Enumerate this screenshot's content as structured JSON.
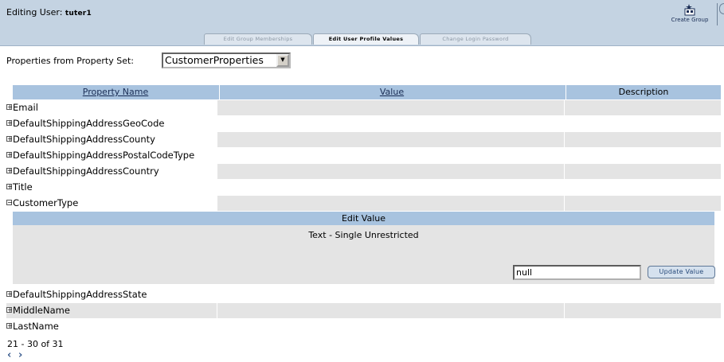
{
  "header": {
    "title_prefix": "Editing User: ",
    "username": "tuter1",
    "create_group_label": "Create Group"
  },
  "tabs": [
    {
      "label": "Edit Group Memberships",
      "active": false
    },
    {
      "label": "Edit User Profile Values",
      "active": true
    },
    {
      "label": "Change Login Password",
      "active": false
    }
  ],
  "property_set": {
    "label": "Properties from Property Set:",
    "selected": "CustomerProperties"
  },
  "table": {
    "columns": [
      "Property Name",
      "Value",
      "Description"
    ],
    "rows_before_edit": [
      {
        "name": "Email",
        "expander": "+"
      },
      {
        "name": "DefaultShippingAddressGeoCode",
        "expander": "+"
      },
      {
        "name": "DefaultShippingAddressCounty",
        "expander": "+"
      },
      {
        "name": "DefaultShippingAddressPostalCodeType",
        "expander": "+"
      },
      {
        "name": "DefaultShippingAddressCountry",
        "expander": "+"
      },
      {
        "name": "Title",
        "expander": "+"
      },
      {
        "name": "CustomerType",
        "expander": "−"
      }
    ],
    "rows_after_edit": [
      {
        "name": "DefaultShippingAddressState",
        "expander": "+"
      },
      {
        "name": "MiddleName",
        "expander": "+"
      },
      {
        "name": "LastName",
        "expander": "+"
      }
    ]
  },
  "edit_panel": {
    "heading": "Edit Value",
    "type_label": "Text - Single Unrestricted",
    "input_value": "null",
    "button_label": "Update Value"
  },
  "pager": {
    "range_text": "21 - 30 of 31",
    "prev_icon": "chevron-left-icon",
    "next_icon": "chevron-right-icon"
  },
  "colors": {
    "header_bg": "#c4d3e2",
    "table_header_bg": "#a8c3df",
    "row_shade": "#e4e4e4",
    "link_blue": "#1a2d55"
  }
}
